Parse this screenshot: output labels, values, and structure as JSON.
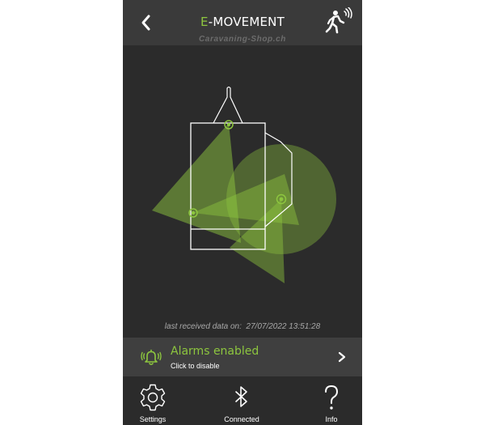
{
  "header": {
    "title_accent": "E",
    "title_rest": "-MOVEMENT",
    "back_icon": "chevron-left-icon",
    "motion_icon": "walking-person-signal-icon"
  },
  "watermark": "Caravaning-Shop.ch",
  "status": {
    "last_received_label": "last received data on:",
    "last_received_value": "27/07/2022 13:51:28"
  },
  "alarm": {
    "title": "Alarms enabled",
    "subtitle": "Click to disable",
    "icon": "bell-ringing-icon",
    "chevron_icon": "chevron-right-icon"
  },
  "tabs": [
    {
      "label": "Settings",
      "icon": "gear-icon"
    },
    {
      "label": "Connected",
      "icon": "bluetooth-icon"
    },
    {
      "label": "Info",
      "icon": "question-mark-icon"
    }
  ],
  "colors": {
    "accent": "#8dc63f",
    "background": "#2b2b2b",
    "header": "#3a3a3a",
    "sensor_zone": "#8dc63f"
  }
}
